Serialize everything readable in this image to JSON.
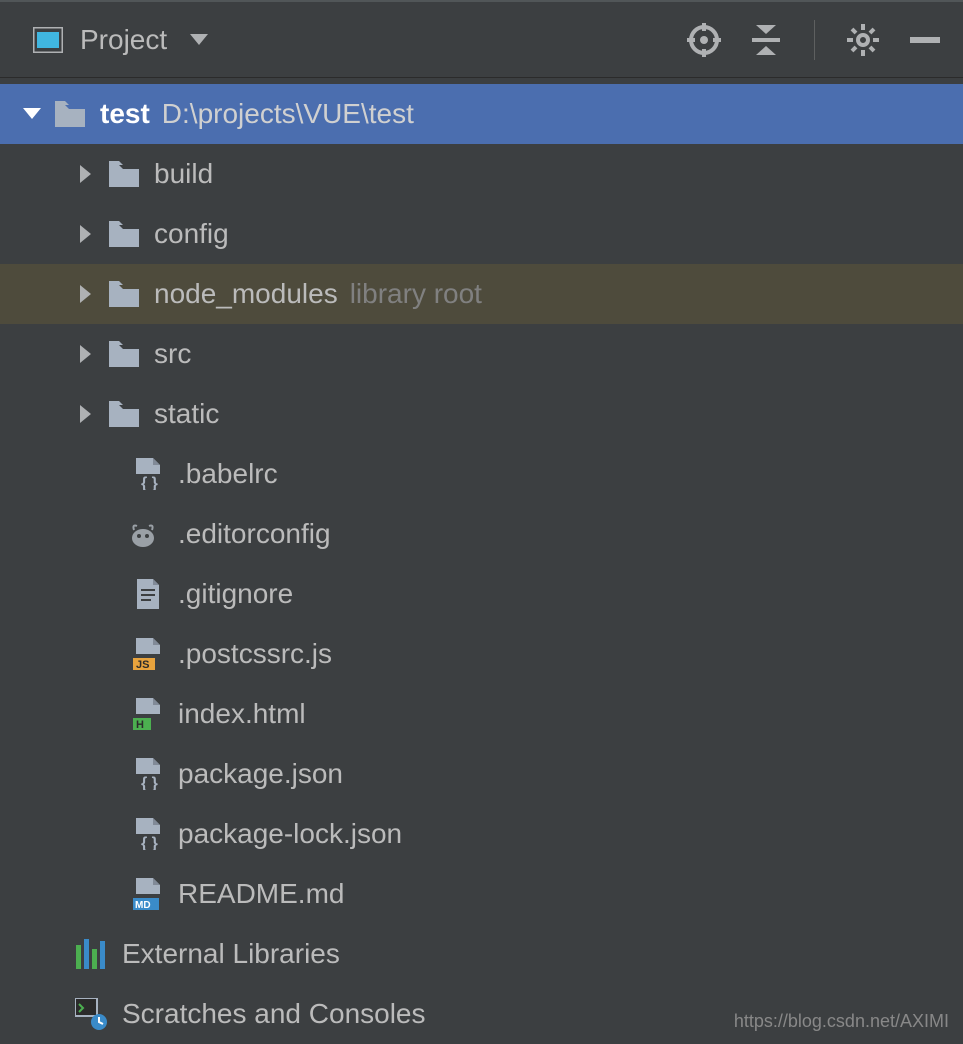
{
  "toolbar": {
    "title": "Project"
  },
  "tree": {
    "root": {
      "name": "test",
      "path": "D:\\projects\\VUE\\test"
    },
    "folders": [
      {
        "name": "build"
      },
      {
        "name": "config"
      },
      {
        "name": "node_modules",
        "suffix": "library root"
      },
      {
        "name": "src"
      },
      {
        "name": "static"
      }
    ],
    "files": [
      {
        "name": ".babelrc",
        "type": "json"
      },
      {
        "name": ".editorconfig",
        "type": "editorconfig"
      },
      {
        "name": ".gitignore",
        "type": "text"
      },
      {
        "name": ".postcssrc.js",
        "type": "js"
      },
      {
        "name": "index.html",
        "type": "html"
      },
      {
        "name": "package.json",
        "type": "json"
      },
      {
        "name": "package-lock.json",
        "type": "json"
      },
      {
        "name": "README.md",
        "type": "md"
      }
    ],
    "bottom": [
      {
        "name": "External Libraries",
        "type": "libs"
      },
      {
        "name": "Scratches and Consoles",
        "type": "scratches"
      }
    ]
  },
  "watermark": "https://blog.csdn.net/AXIMI"
}
